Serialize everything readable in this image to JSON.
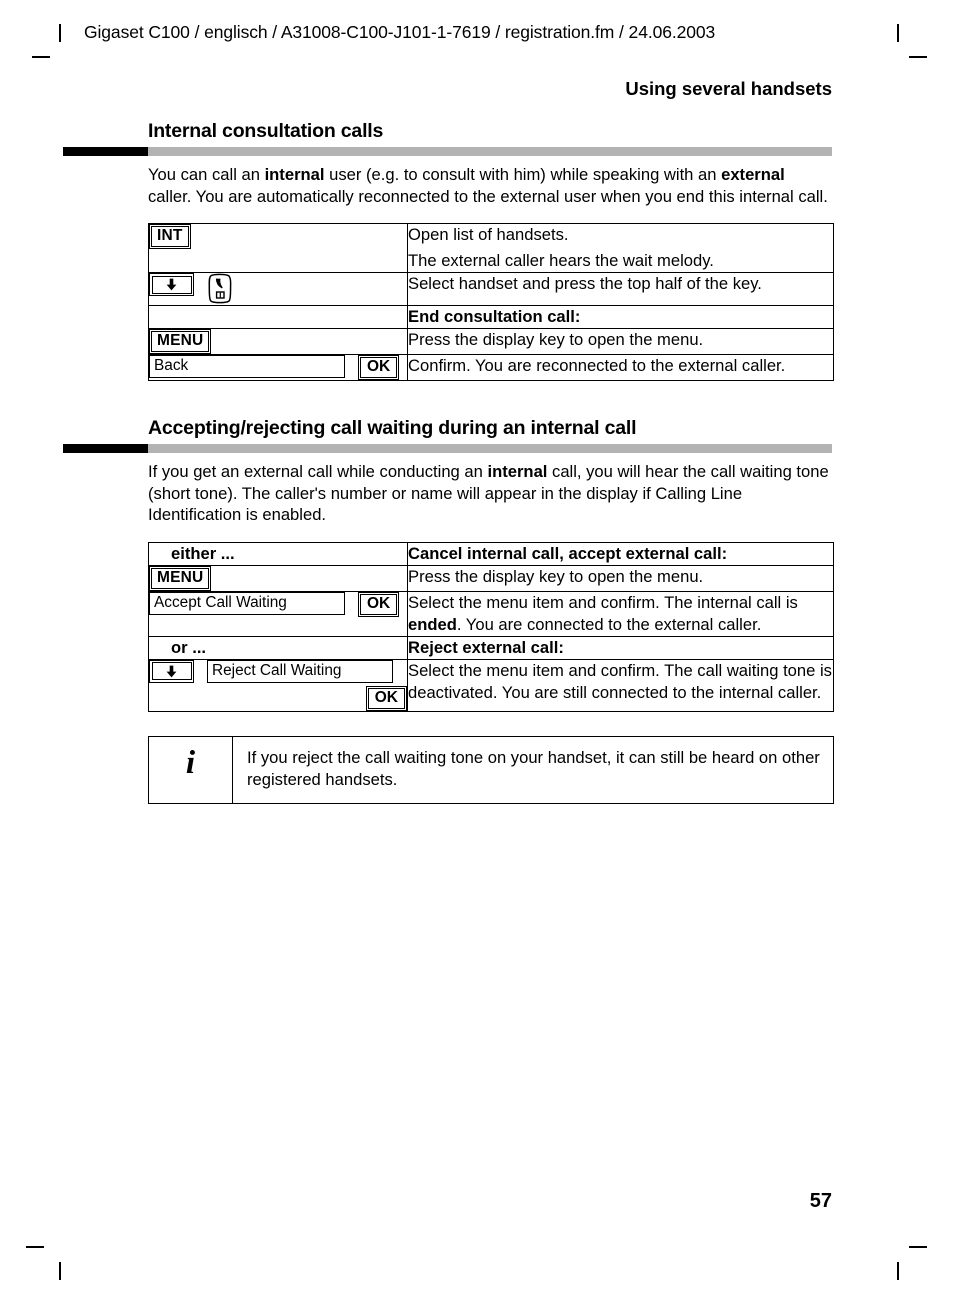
{
  "header": {
    "file_line": "Gigaset C100 / englisch / A31008-C100-J101-1-7619 / registration.fm / 24.06.2003",
    "chapter_title": "Using several handsets"
  },
  "sections": [
    {
      "heading": "Internal consultation calls",
      "intro_html": "You can call an <b>internal</b> user (e.g. to consult with him) while speaking with an <b>external</b> caller. You are automatically reconnected to the external user when you end this internal call.",
      "table": {
        "rows": [
          {
            "key_type": "softkey",
            "key_label": "INT",
            "desc_line1": "Open list of handsets.",
            "desc_line2": "The external caller hears the wait melody."
          },
          {
            "key_type": "arrow-talk",
            "arrow_icon": "down-arrow-icon",
            "talk_icon": "talk-key-icon",
            "desc_line1": "Select handset and press the top half of the key."
          },
          {
            "key_type": "empty",
            "key_label": "",
            "desc_line1": "End consultation call:",
            "desc_bold": true
          },
          {
            "key_type": "softkey",
            "key_label": "MENU",
            "desc_line1": "Press the display key to open the menu."
          },
          {
            "key_type": "menufield-ok",
            "menu_field": "Back",
            "ok_label": "OK",
            "desc_line1": "Confirm. You are reconnected to the external caller."
          }
        ]
      }
    },
    {
      "heading": "Accepting/rejecting call waiting during an internal call",
      "intro_html": "If you get an external call while conducting an <b>internal</b> call, you will hear the call waiting tone (short tone). The caller's number or name will appear in the display if Calling Line Identification is enabled.",
      "table": {
        "rows": [
          {
            "key_type": "plain-label",
            "key_label": "either ...",
            "desc_line1": "Cancel internal call, accept external call:",
            "desc_bold": true
          },
          {
            "key_type": "softkey",
            "key_label": "MENU",
            "desc_line1": "Press the display key to open the menu."
          },
          {
            "key_type": "menufield-ok",
            "menu_field": "Accept Call Waiting",
            "ok_label": "OK",
            "desc_html": "Select the menu item and confirm. The internal call is <b>ended</b>. You are connected to the external caller."
          },
          {
            "key_type": "plain-label",
            "key_label": "or ...",
            "desc_line1": "Reject external call:",
            "desc_bold": true
          },
          {
            "key_type": "arrow-menufield-ok",
            "arrow_icon": "down-arrow-icon",
            "menu_field": "Reject Call Waiting",
            "ok_label": "OK",
            "desc_line1": "Select the menu item and confirm. The call waiting tone is deactivated. You are still connected to the internal caller."
          }
        ]
      }
    }
  ],
  "note": {
    "icon": "info-i-icon",
    "icon_glyph": "i",
    "text": "If you reject the call waiting tone on your handset, it can still be heard on other registered handsets."
  },
  "folio": "57",
  "colors": {
    "rule_gray": "#b3b3b3",
    "rule_black": "#000000",
    "text": "#000000",
    "page_background": "#ffffff"
  }
}
